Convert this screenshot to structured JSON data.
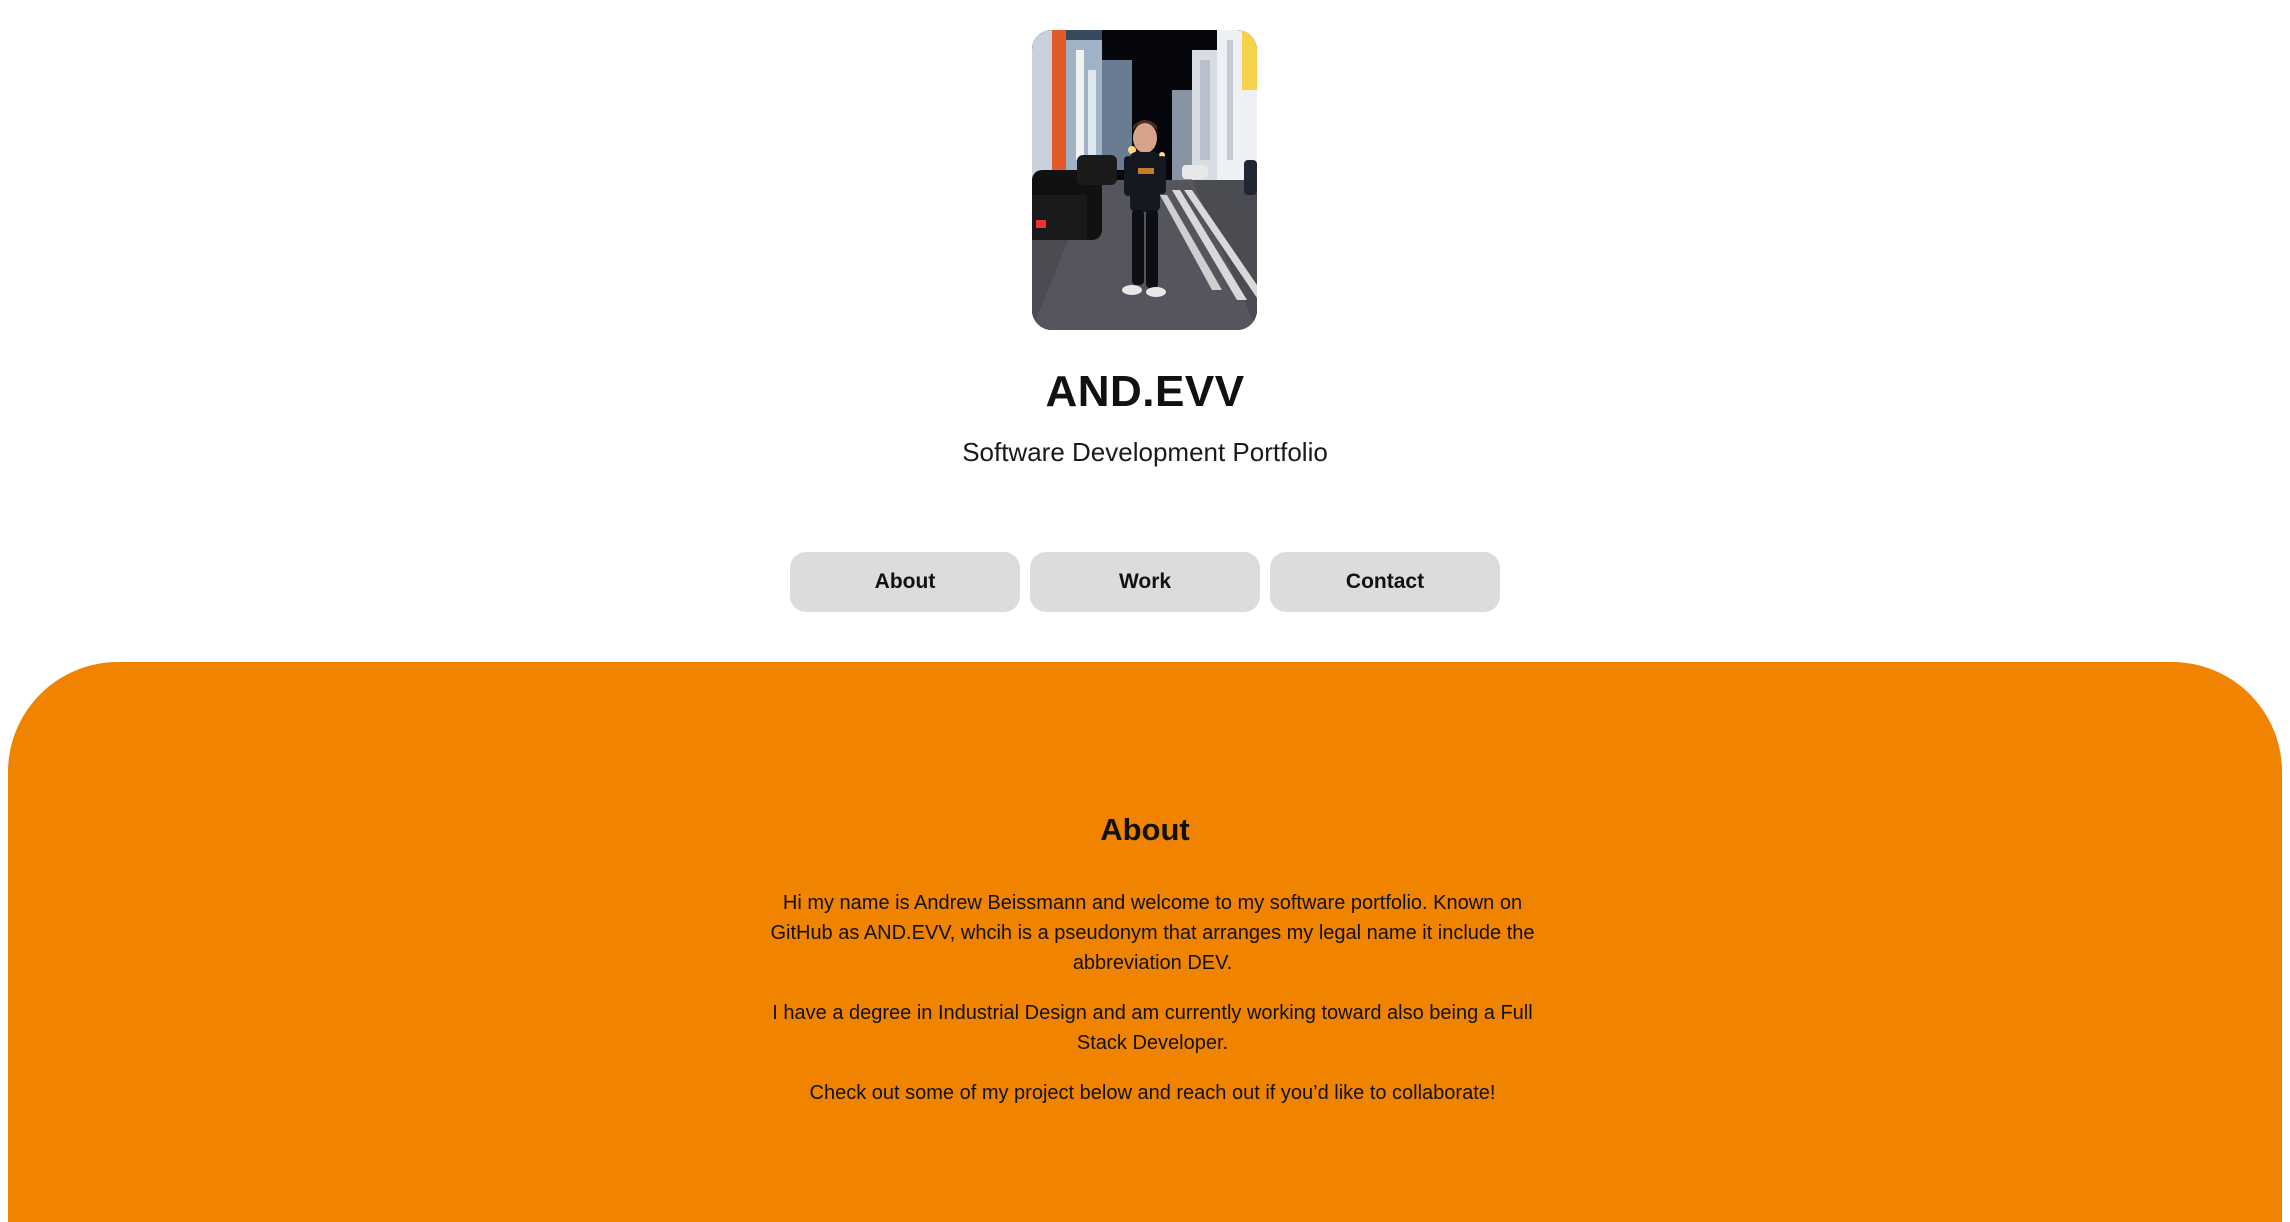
{
  "profile": {
    "photo_alt": "portrait-photo",
    "title": "AND.EVV",
    "subtitle": "Software Development Portfolio"
  },
  "nav": {
    "items": [
      {
        "label": "About"
      },
      {
        "label": "Work"
      },
      {
        "label": "Contact"
      }
    ]
  },
  "about": {
    "heading": "About",
    "paragraphs": [
      "Hi my name is Andrew Beissmann and welcome to my software portfolio. Known on GitHub as AND.EVV, whcih is a pseudonym that arranges my legal name it include the abbreviation DEV.",
      "I have a degree in Industrial Design and am currently working toward also being a Full Stack Developer.",
      "Check out some of my project below and reach out if you’d like to collaborate!"
    ]
  },
  "colors": {
    "accent": "#f08300",
    "nav_button_bg": "#dcdcdc",
    "page_bg": "#ffffff"
  }
}
